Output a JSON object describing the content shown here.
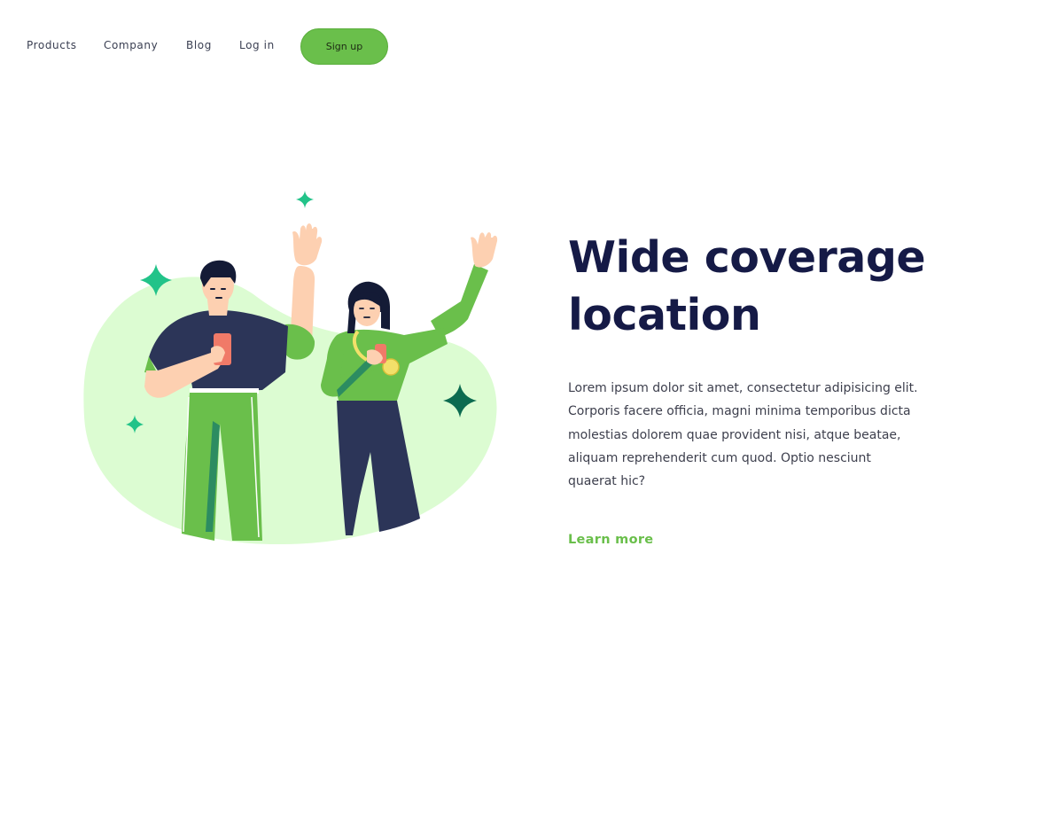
{
  "nav": {
    "links": [
      {
        "label": "Products"
      },
      {
        "label": "Company"
      },
      {
        "label": "Blog"
      },
      {
        "label": "Log in"
      }
    ],
    "signup_label": "Sign up"
  },
  "hero": {
    "illustration_icon": "waving-people-illustration",
    "title": "Wide coverage location",
    "body": "Lorem ipsum dolor sit amet, consectetur adipisicing elit. Corporis facere officia, magni minima temporibus dicta molestias dolorem quae provident nisi, atque beatae, aliquam reprehenderit cum quod. Optio nesciunt quaerat hic?",
    "cta_label": "Learn more"
  },
  "colors": {
    "accent_green": "#6abf4b",
    "headline_navy": "#151a46",
    "blob_mint": "#dcfcd2",
    "sparkle_teal": "#22c389",
    "sparkle_dark": "#0c6b50"
  }
}
